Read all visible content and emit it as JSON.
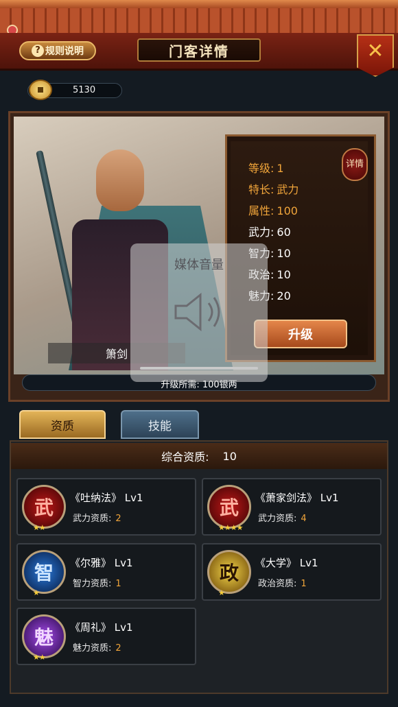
{
  "header": {
    "rules_label": "规则说明",
    "title": "门客详情",
    "close_symbol": "✕"
  },
  "currency": {
    "amount": "5130"
  },
  "hero": {
    "name": "箫剑",
    "detail_badge": "详情",
    "stats": [
      {
        "label": "等级:",
        "value": "1",
        "highlight": true
      },
      {
        "label": "特长:",
        "value": "武力",
        "highlight": true
      },
      {
        "label": "属性:",
        "value": "100",
        "highlight": true
      },
      {
        "label": "武力:",
        "value": "60",
        "highlight": false
      },
      {
        "label": "智力:",
        "value": "10",
        "highlight": false
      },
      {
        "label": "政治:",
        "value": "10",
        "highlight": false
      },
      {
        "label": "魅力:",
        "value": "20",
        "highlight": false
      }
    ],
    "upgrade_label": "升级",
    "upgrade_cost": "升级所需: 100银两",
    "upgrade_progress_percent": 0
  },
  "overlay": {
    "volume_label": "媒体音量"
  },
  "tabs": [
    {
      "label": "资质",
      "active": true
    },
    {
      "label": "技能",
      "active": false
    }
  ],
  "aptitude": {
    "total_label": "综合资质:",
    "total_value": "10",
    "skills": [
      {
        "title": "《吐纳法》 Lv1",
        "stat_label": "武力资质:",
        "stat_value": "2",
        "emblem": "武",
        "color": "#c01818",
        "stars": "★★"
      },
      {
        "title": "《萧家剑法》 Lv1",
        "stat_label": "武力资质:",
        "stat_value": "4",
        "emblem": "武",
        "color": "#c01818",
        "stars": "★★★★"
      },
      {
        "title": "《尔雅》 Lv1",
        "stat_label": "智力资质:",
        "stat_value": "1",
        "emblem": "智",
        "color": "#2a78d8",
        "stars": "★"
      },
      {
        "title": "《大学》 Lv1",
        "stat_label": "政治资质:",
        "stat_value": "1",
        "emblem": "政",
        "color": "#f1d34a",
        "stars": "★"
      },
      {
        "title": "《周礼》 Lv1",
        "stat_label": "魅力资质:",
        "stat_value": "2",
        "emblem": "魅",
        "color": "#a34ae8",
        "stars": "★★"
      }
    ]
  }
}
